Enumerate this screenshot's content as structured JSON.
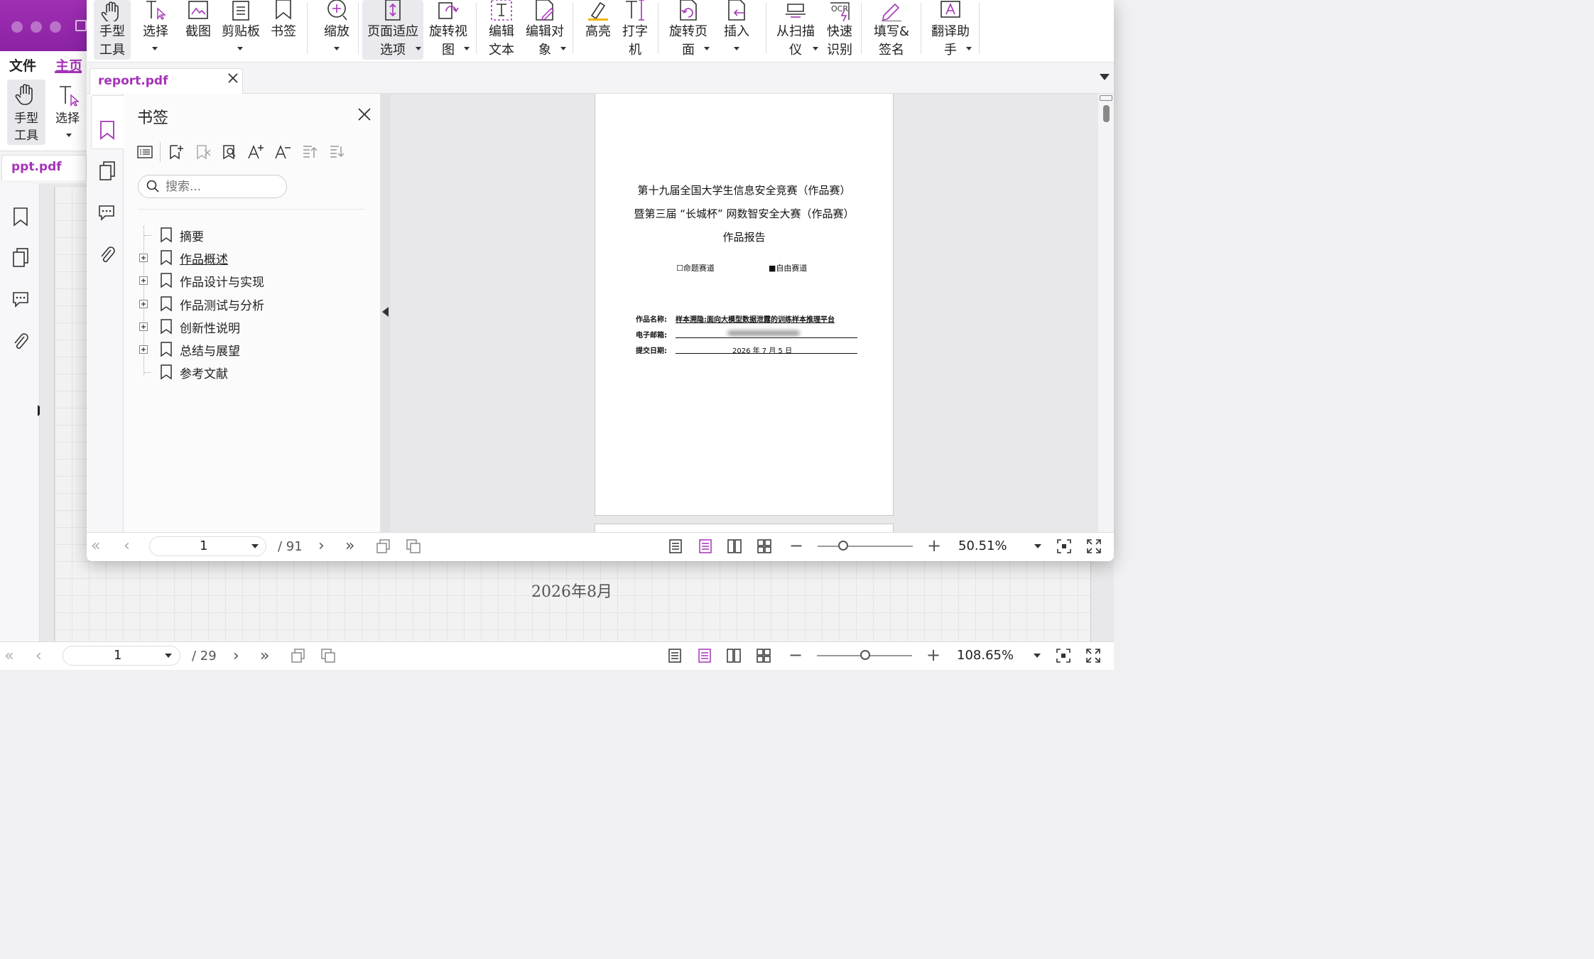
{
  "background_window": {
    "menu": {
      "file": "文件",
      "home": "主页"
    },
    "ribbon": {
      "hand_tool": "手型\n工具",
      "select": "选择"
    },
    "tab": {
      "label": "ppt.pdf"
    },
    "page_text": "2026年8月",
    "statusbar": {
      "current_page": "1",
      "total_pages": "/ 29",
      "zoom": "108.65%"
    }
  },
  "foreground_window": {
    "ribbon": [
      {
        "id": "hand",
        "label": "手型\n工具",
        "icon": "hand-icon",
        "dropdown": false
      },
      {
        "id": "select",
        "label": "选择",
        "icon": "cursor-text-icon",
        "dropdown": true
      },
      {
        "id": "screenshot",
        "label": "截图",
        "icon": "screenshot-icon",
        "dropdown": false
      },
      {
        "id": "clipboard",
        "label": "剪贴板",
        "icon": "clipboard-icon",
        "dropdown": true
      },
      {
        "id": "bookmark",
        "label": "书签",
        "icon": "bookmark-icon",
        "dropdown": false
      },
      {
        "id": "zoom",
        "label": "缩放",
        "icon": "zoom-in-icon",
        "dropdown": true
      },
      {
        "id": "fit-page",
        "label": "页面适应\n选项",
        "icon": "fit-page-icon",
        "dropdown": true
      },
      {
        "id": "rotate-view",
        "label": "旋转视\n图",
        "icon": "rotate-view-icon",
        "dropdown": true
      },
      {
        "id": "edit-text",
        "label": "编辑\n文本",
        "icon": "edit-text-icon",
        "dropdown": false
      },
      {
        "id": "edit-object",
        "label": "编辑对\n象",
        "icon": "edit-object-icon",
        "dropdown": true
      },
      {
        "id": "highlight",
        "label": "高亮",
        "icon": "highlight-icon",
        "dropdown": false
      },
      {
        "id": "typewriter",
        "label": "打字\n机",
        "icon": "typewriter-icon",
        "dropdown": false
      },
      {
        "id": "rotate-page",
        "label": "旋转页\n面",
        "icon": "rotate-page-icon",
        "dropdown": true
      },
      {
        "id": "insert",
        "label": "插入",
        "icon": "insert-page-icon",
        "dropdown": true
      },
      {
        "id": "from-scanner",
        "label": "从扫描\n仪",
        "icon": "scanner-icon",
        "dropdown": true
      },
      {
        "id": "quick-ocr",
        "label": "快速\n识别",
        "icon": "ocr-icon",
        "dropdown": false
      },
      {
        "id": "fill-sign",
        "label": "填写&\n签名",
        "icon": "sign-icon",
        "dropdown": false
      },
      {
        "id": "translate",
        "label": "翻译助\n手",
        "icon": "translate-icon",
        "dropdown": true
      }
    ],
    "tab": {
      "label": "report.pdf"
    },
    "bookmarks": {
      "title": "书签",
      "search_placeholder": "搜索...",
      "items": [
        {
          "label": "摘要",
          "expandable": false
        },
        {
          "label": "作品概述",
          "expandable": true
        },
        {
          "label": "作品设计与实现",
          "expandable": true
        },
        {
          "label": "作品测试与分析",
          "expandable": true
        },
        {
          "label": "创新性说明",
          "expandable": true
        },
        {
          "label": "总结与展望",
          "expandable": true
        },
        {
          "label": "参考文献",
          "expandable": false
        }
      ]
    },
    "document": {
      "title_line1": "第十九届全国大学生信息安全竞赛（作品赛）",
      "title_line2": "暨第三届 “长城杯” 网数智安全大赛（作品赛）",
      "title_line3": "作品报告",
      "track_option1": "☐命题赛道",
      "track_option2": "■自由赛道",
      "field_name_label": "作品名称:",
      "field_name_value": "样本溯隐:面向大模型数据泄露的训练样本推理平台",
      "field_email_label": "电子邮箱:",
      "field_date_label": "提交日期:",
      "field_date_value": "2026 年 7 月 5 日"
    },
    "statusbar": {
      "current_page": "1",
      "total_pages": "/ 91",
      "zoom": "50.51%"
    }
  },
  "colors": {
    "accent": "#a533b8",
    "titlebar": "#9a2bb0"
  }
}
